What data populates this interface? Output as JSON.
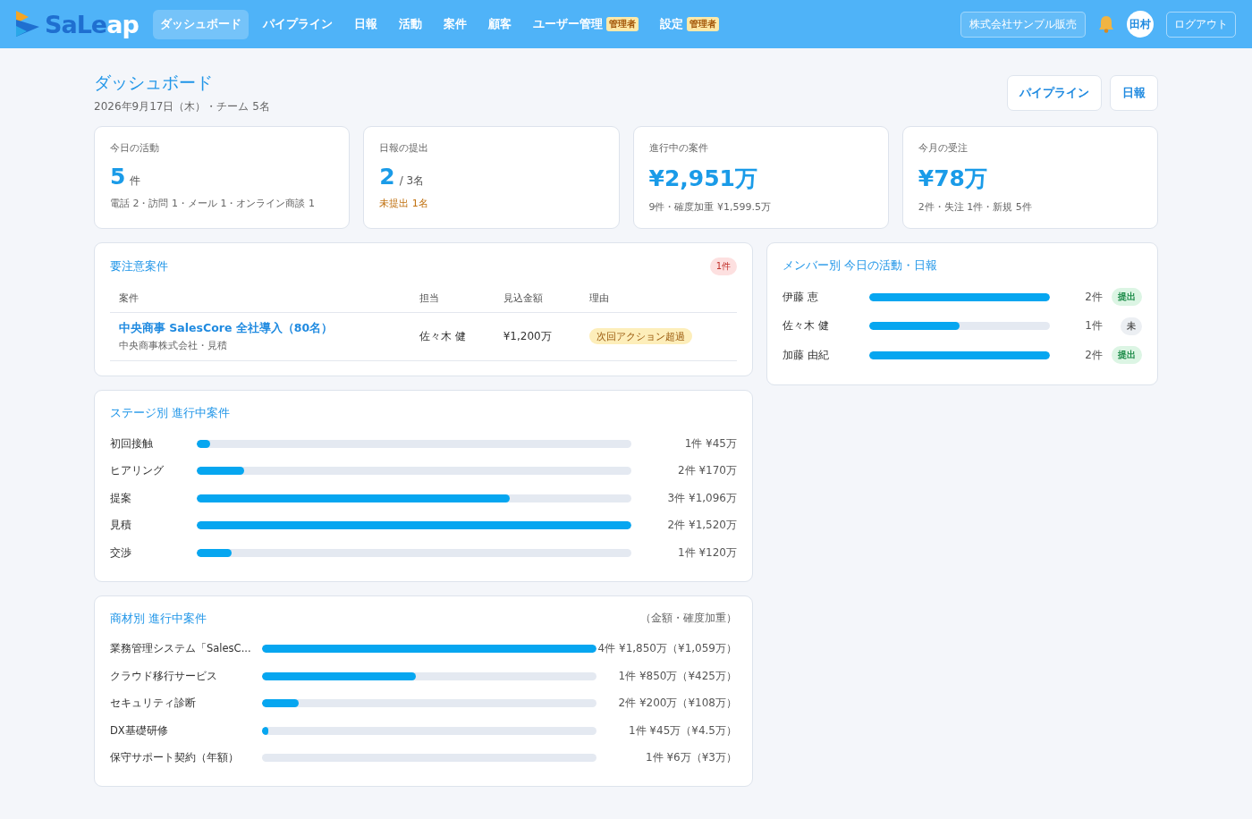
{
  "header": {
    "logo": [
      "SaLe",
      "ap"
    ],
    "nav": [
      {
        "label": "ダッシュボード",
        "selected": true
      },
      {
        "label": "パイプライン",
        "selected": false
      },
      {
        "label": "日報",
        "selected": false
      },
      {
        "label": "活動",
        "selected": false
      },
      {
        "label": "案件",
        "selected": false
      },
      {
        "label": "顧客",
        "selected": false
      },
      {
        "label": "ユーザー管理",
        "badge": "管理者",
        "selected": false
      },
      {
        "label": "設定",
        "badge": "管理者",
        "selected": false
      }
    ],
    "company": "株式会社サンプル販売",
    "avatar": "田村",
    "logout": "ログアウト"
  },
  "page": {
    "title": "ダッシュボード",
    "subtitle": "2026年9月17日（木）・チーム 5名",
    "actions": [
      "パイプライン",
      "日報"
    ]
  },
  "stats": [
    {
      "label": "今日の活動",
      "value": "5",
      "unit": "件",
      "sub": "電話 2・訪問 1・メール 1・オンライン商談 1",
      "alert": false
    },
    {
      "label": "日報の提出",
      "value": "2",
      "unit": "/ 3名",
      "sub": "未提出 1名",
      "alert": true
    },
    {
      "label": "進行中の案件",
      "value": "¥2,951万",
      "sub": "9件・確度加重 ¥1,599.5万",
      "alert": false
    },
    {
      "label": "今月の受注",
      "value": "¥78万",
      "sub": "2件・失注 1件・新規 5件",
      "alert": false
    }
  ],
  "attention": {
    "title": "要注意案件",
    "count": "1件",
    "columns": [
      "案件",
      "担当",
      "見込金額",
      "理由"
    ],
    "rows": [
      {
        "deal": "中央商事 SalesCore 全社導入（80名）",
        "detail": "中央商事株式会社・見積",
        "owner": "佐々木 健",
        "amount": "¥1,200万",
        "reason": "次回アクション超過"
      }
    ]
  },
  "members": {
    "title": "メンバー別 今日の活動・日報",
    "rows": [
      {
        "name": "伊藤 恵",
        "level": 1,
        "count": "2件",
        "status": "提出",
        "submitted": true
      },
      {
        "name": "佐々木 健",
        "level": 0.5,
        "count": "1件",
        "status": "未",
        "submitted": false
      },
      {
        "name": "加藤 由紀",
        "level": 1,
        "count": "2件",
        "status": "提出",
        "submitted": true
      }
    ]
  },
  "stages": {
    "title": "ステージ別 進行中案件",
    "rows": [
      {
        "name": "初回接触",
        "level": 0.03,
        "value": "1件 ¥45万"
      },
      {
        "name": "ヒアリング",
        "level": 0.11,
        "value": "2件 ¥170万"
      },
      {
        "name": "提案",
        "level": 0.72,
        "value": "3件 ¥1,096万"
      },
      {
        "name": "見積",
        "level": 1,
        "value": "2件 ¥1,520万"
      },
      {
        "name": "交渉",
        "level": 0.08,
        "value": "1件 ¥120万"
      }
    ]
  },
  "products": {
    "title": "商材別 進行中案件",
    "note": "（金額・確度加重）",
    "rows": [
      {
        "name": "業務管理システム「SalesC...",
        "level": 1,
        "value": "4件 ¥1,850万（¥1,059万）"
      },
      {
        "name": "クラウド移行サービス",
        "level": 0.46,
        "value": "1件 ¥850万（¥425万）"
      },
      {
        "name": "セキュリティ診断",
        "level": 0.11,
        "value": "2件 ¥200万（¥108万）"
      },
      {
        "name": "DX基礎研修",
        "level": 0.02,
        "value": "1件 ¥45万（¥4.5万）"
      },
      {
        "name": "保守サポート契約（年額）",
        "value": "1件 ¥6万（¥3万）"
      }
    ]
  }
}
